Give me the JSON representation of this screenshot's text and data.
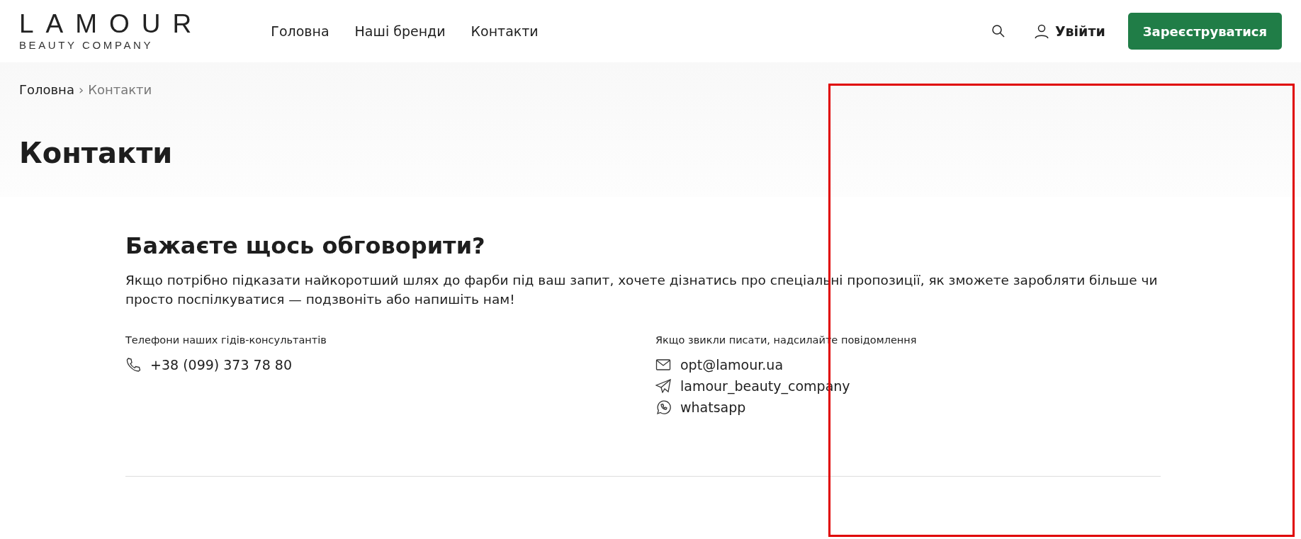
{
  "header": {
    "logo": {
      "name": "LAMOUR",
      "tagline": "BEAUTY COMPANY"
    },
    "nav": [
      {
        "label": "Головна"
      },
      {
        "label": "Наші бренди"
      },
      {
        "label": "Контакти"
      }
    ],
    "login": "Увійти",
    "register": "Зареєструватися"
  },
  "breadcrumb": [
    {
      "label": "Головна"
    },
    {
      "label": "Контакти"
    }
  ],
  "breadcrumb_separator": "›",
  "page_title": "Контакти",
  "contact": {
    "heading": "Бажаєте щось обговорити?",
    "intro": "Якщо потрібно підказати найкоротший шлях до фарби під ваш запит, хочете дізнатись про спеціальні пропозиції, як зможете заробляти більше чи просто поспілкуватися — подзвоніть або напишіть нам!",
    "columns": [
      {
        "label": "Телефони наших гідів-консультантів",
        "items": [
          {
            "kind": "phone",
            "text": "+38 (099) 373 78 80"
          }
        ]
      },
      {
        "label": "Якщо звикли писати, надсилайте повідомлення",
        "items": [
          {
            "kind": "email",
            "text": "opt@lamour.ua"
          },
          {
            "kind": "telegram",
            "text": "lamour_beauty_company"
          },
          {
            "kind": "whatsapp",
            "text": "whatsapp"
          }
        ]
      }
    ]
  }
}
